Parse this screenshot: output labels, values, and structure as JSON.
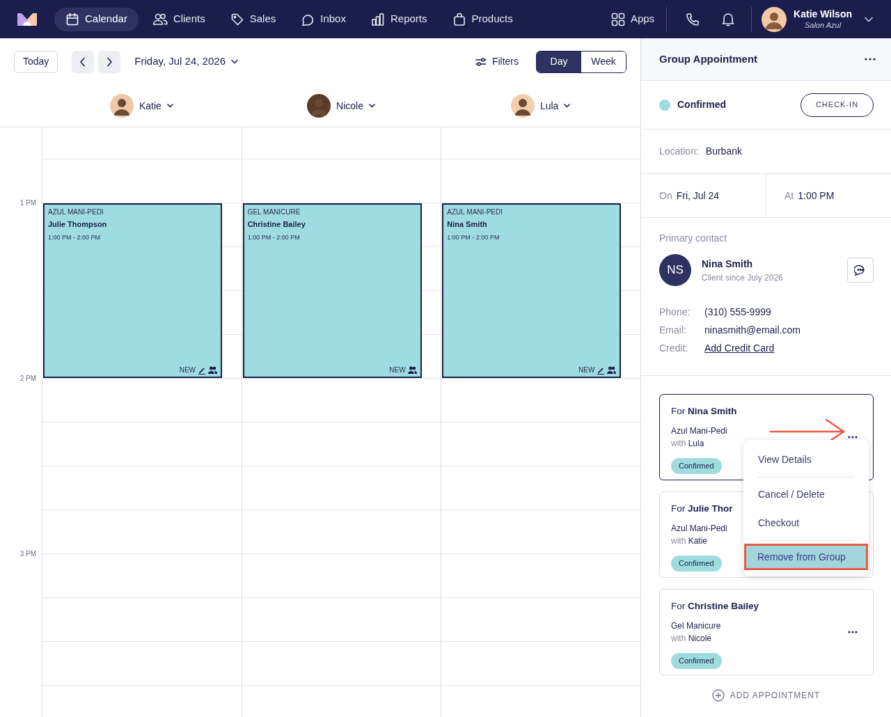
{
  "nav": {
    "items": [
      {
        "label": "Calendar",
        "selected": true
      },
      {
        "label": "Clients",
        "selected": false
      },
      {
        "label": "Sales",
        "selected": false
      },
      {
        "label": "Inbox",
        "selected": false
      },
      {
        "label": "Reports",
        "selected": false
      },
      {
        "label": "Products",
        "selected": false
      }
    ],
    "apps": "Apps",
    "user": {
      "name": "Katie Wilson",
      "salon": "Salon Azul"
    }
  },
  "toolbar": {
    "today": "Today",
    "date": "Friday, Jul 24, 2026",
    "filters": "Filters",
    "views": [
      {
        "label": "Day",
        "selected": true
      },
      {
        "label": "Week",
        "selected": false
      }
    ]
  },
  "staff": [
    {
      "name": "Katie"
    },
    {
      "name": "Nicole"
    },
    {
      "name": "Lula"
    }
  ],
  "time_labels": [
    "1 PM",
    "2 PM",
    "3 PM"
  ],
  "appointments": [
    {
      "service": "AZUL MANI-PEDI",
      "client": "Julie Thompson",
      "time": "1:00 PM - 2:00 PM",
      "badge": "NEW",
      "edited": true
    },
    {
      "service": "GEL MANICURE",
      "client": "Christine Bailey",
      "time": "1:00 PM - 2:00 PM",
      "badge": "NEW",
      "edited": false
    },
    {
      "service": "AZUL MANI-PEDI",
      "client": "Nina Smith",
      "time": "1:00 PM - 2:00 PM",
      "badge": "NEW",
      "edited": true
    }
  ],
  "panel": {
    "title": "Group Appointment",
    "status": "Confirmed",
    "checkin": "CHECK-IN",
    "location": {
      "label": "Location:",
      "value": "Burbank"
    },
    "date": {
      "label": "On",
      "value": "Fri, Jul 24"
    },
    "time": {
      "label": "At",
      "value": "1:00 PM"
    },
    "primary_label": "Primary contact",
    "contact": {
      "initials": "NS",
      "name": "Nina Smith",
      "since": "Client since July 2026"
    },
    "fields": [
      {
        "label": "Phone:",
        "value": "(310) 555-9999",
        "kind": "text"
      },
      {
        "label": "Email:",
        "value": "ninasmith@email.com",
        "kind": "text"
      },
      {
        "label": "Credit:",
        "value": "Add Credit Card",
        "kind": "link"
      }
    ],
    "group": [
      {
        "prefix": "For",
        "client": "Nina Smith",
        "service": "Azul Mani-Pedi",
        "with": "with",
        "staff": "Lula",
        "status": "Confirmed",
        "active": true
      },
      {
        "prefix": "For",
        "client": "Julie Thor",
        "service": "Azul Mani-Pedi",
        "with": "with",
        "staff": "Katie",
        "status": "Confirmed",
        "active": false
      },
      {
        "prefix": "For",
        "client": "Christine Bailey",
        "service": "Gel Manicure",
        "with": "with",
        "staff": "Nicole",
        "status": "Confirmed",
        "active": false
      }
    ],
    "menu": [
      [
        {
          "label": "View Details",
          "selected": false
        }
      ],
      [
        {
          "label": "Cancel / Delete",
          "selected": false
        },
        {
          "label": "Checkout",
          "selected": false
        }
      ],
      [
        {
          "label": "Remove from Group",
          "selected": true
        }
      ]
    ],
    "add": "ADD APPOINTMENT"
  }
}
